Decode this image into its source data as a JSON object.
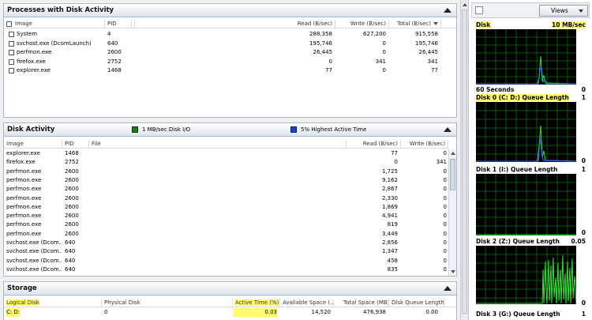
{
  "processes_panel": {
    "title": "Processes with Disk Activity",
    "columns": [
      "Image",
      "PID",
      "Read (B/sec)",
      "Write (B/sec)",
      "Total (B/sec)"
    ],
    "rows": [
      {
        "image": "System",
        "pid": "4",
        "read": "288,358",
        "write": "627,200",
        "total": "915,558"
      },
      {
        "image": "svchost.exe (DcomLaunch)",
        "pid": "640",
        "read": "195,746",
        "write": "0",
        "total": "195,746"
      },
      {
        "image": "perfmon.exe",
        "pid": "2600",
        "read": "26,445",
        "write": "0",
        "total": "26,445"
      },
      {
        "image": "firefox.exe",
        "pid": "2752",
        "read": "0",
        "write": "341",
        "total": "341"
      },
      {
        "image": "explorer.exe",
        "pid": "1468",
        "read": "77",
        "write": "0",
        "total": "77"
      }
    ]
  },
  "disk_activity_panel": {
    "title": "Disk Activity",
    "legend_io": "1 MB/sec Disk I/O",
    "legend_active": "5% Highest Active Time",
    "io_color": "#1a7a1a",
    "active_color": "#1f3fbf",
    "columns": [
      "Image",
      "PID",
      "File",
      "Read (B/sec)",
      "Write (B/sec)"
    ],
    "rows": [
      {
        "image": "explorer.exe",
        "pid": "1468",
        "read": "77",
        "write": "0"
      },
      {
        "image": "firefox.exe",
        "pid": "2752",
        "read": "0",
        "write": "341"
      },
      {
        "image": "perfmon.exe",
        "pid": "2600",
        "read": "1,725",
        "write": "0"
      },
      {
        "image": "perfmon.exe",
        "pid": "2600",
        "read": "9,162",
        "write": "0"
      },
      {
        "image": "perfmon.exe",
        "pid": "2600",
        "read": "2,867",
        "write": "0"
      },
      {
        "image": "perfmon.exe",
        "pid": "2600",
        "read": "2,330",
        "write": "0"
      },
      {
        "image": "perfmon.exe",
        "pid": "2600",
        "read": "1,869",
        "write": "0"
      },
      {
        "image": "perfmon.exe",
        "pid": "2600",
        "read": "4,941",
        "write": "0"
      },
      {
        "image": "perfmon.exe",
        "pid": "2600",
        "read": "819",
        "write": "0"
      },
      {
        "image": "perfmon.exe",
        "pid": "2600",
        "read": "3,449",
        "write": "0"
      },
      {
        "image": "svchost.exe (Dcom...",
        "pid": "640",
        "read": "2,856",
        "write": "0"
      },
      {
        "image": "svchost.exe (Dcom...",
        "pid": "640",
        "read": "1,347",
        "write": "0"
      },
      {
        "image": "svchost.exe (Dcom...",
        "pid": "640",
        "read": "458",
        "write": "0"
      },
      {
        "image": "svchost.exe (Dcom...",
        "pid": "640",
        "read": "835",
        "write": "0"
      }
    ]
  },
  "storage_panel": {
    "title": "Storage",
    "columns": [
      "Logical Disk",
      "Physical Disk",
      "Active Time (%)",
      "Available Space (...",
      "Total Space (MB)",
      "Disk Queue Length"
    ],
    "rows": [
      {
        "logical": "C: D:",
        "physical": "0",
        "active": "0.03",
        "available": "14,520",
        "total": "476,938",
        "queue": "0.00"
      }
    ]
  },
  "right_panel": {
    "views_label": "Views",
    "graphs": [
      {
        "label": "Disk",
        "scale": "10 MB/sec",
        "footer_left": "60 Seconds",
        "footer_right": "0"
      },
      {
        "label": "Disk 0 (C: D:) Queue Length",
        "scale": "1",
        "footer_right": "0"
      },
      {
        "label": "Disk 1 (I:) Queue Length",
        "scale": "1",
        "footer_right": "0"
      },
      {
        "label": "Disk 2 (Z:) Queue Length",
        "scale": "0.05",
        "footer_right": "0"
      },
      {
        "label": "Disk 3 (G:) Queue Length",
        "scale": "1"
      }
    ]
  }
}
